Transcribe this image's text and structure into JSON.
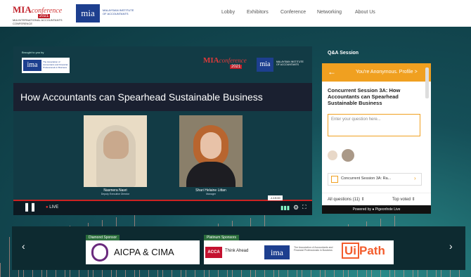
{
  "header": {
    "brand_main": "MIA",
    "brand_script": "conference",
    "brand_year": "2021",
    "brand_sub": "MIA INTERNATIONAL ACCOUNTANTS CONFERENCE",
    "institute_logo": "mia",
    "institute_text": "MALAYSIAN INSTITUTE OF ACCOUNTANTS",
    "nav": [
      "Lobby",
      "Exhibitors",
      "Conference",
      "Networking",
      "About Us"
    ]
  },
  "video": {
    "brought_by": "Brought to you by",
    "ima_logo": "ima",
    "ima_text": "The Association of Accountants and Financial Professionals in Business",
    "mia_main": "MIA",
    "mia_script": "conference",
    "mia_year": "2021",
    "mia_logo": "mia",
    "mia_text": "MALAYSIAN INSTITUTE OF ACCOUNTANTS",
    "title": "How Accountants can Spearhead Sustainable Business",
    "speaker1_name": "Nasmera Nasri",
    "speaker1_role": "Deputy Executive Director",
    "speaker2_name": "Shari Helaine Littan",
    "speaker2_role": "Manager",
    "live_label": "LIVE",
    "time_badge": "-1:19:00",
    "progress": 1.0
  },
  "qa": {
    "heading": "Q&A Session",
    "anon": "You're Anonymous. Profile >",
    "session_title": "Concurrent Session 3A: How Accountants can Spearhead Sustainable Business",
    "input_placeholder": "Enter your question here...",
    "session_button": "Concurrent Session 3A: Ra...",
    "tab_all": "All questions (11) ⇕",
    "tab_top": "Top voted ⇕",
    "powered": "Powered by  ●  Pigeonhole Live"
  },
  "sponsors": {
    "diamond_tag": "Diamond Sponsor",
    "platinum_tag": "Platinum Sponsors",
    "aicpa": "AICPA & CIMA",
    "acca": "ACCA",
    "acca_tag": "Think Ahead",
    "ima": "ima",
    "ima_text": "The Association of Accountants and Financial Professionals in Business",
    "uipath_a": "Ui",
    "uipath_b": "Path"
  },
  "colors": {
    "accent": "#f0a020",
    "brand_red": "#c0202a",
    "brand_blue": "#1d3f8f",
    "live_red": "#e33333"
  },
  "icons": [
    "back-arrow-icon",
    "pause-icon",
    "gear-icon",
    "fullscreen-icon",
    "volume-icon",
    "chevron-left-icon",
    "chevron-right-icon",
    "chevron-right-small-icon",
    "document-icon"
  ]
}
